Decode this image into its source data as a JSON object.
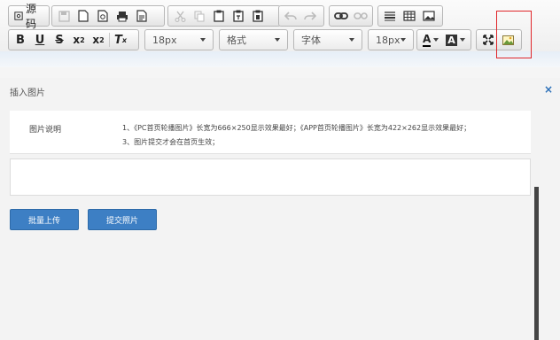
{
  "toolbar": {
    "source_label": "源码",
    "font_size_select": "18px",
    "format_select": "格式",
    "font_family_select": "字体",
    "font_size_select_2": "18px",
    "text_color_label": "A",
    "bg_color_label": "A"
  },
  "dialog": {
    "title": "插入图片",
    "close_icon": "×",
    "info_label": "图片说明",
    "notes": [
      "1、《PC首页轮播图片》长宽为666×250显示效果最好；《APP首页轮播图片》长宽为422×262显示效果最好；",
      "3、图片提交才会在首页生效；"
    ],
    "batch_upload_button": "批量上传",
    "submit_button": "提交照片"
  }
}
